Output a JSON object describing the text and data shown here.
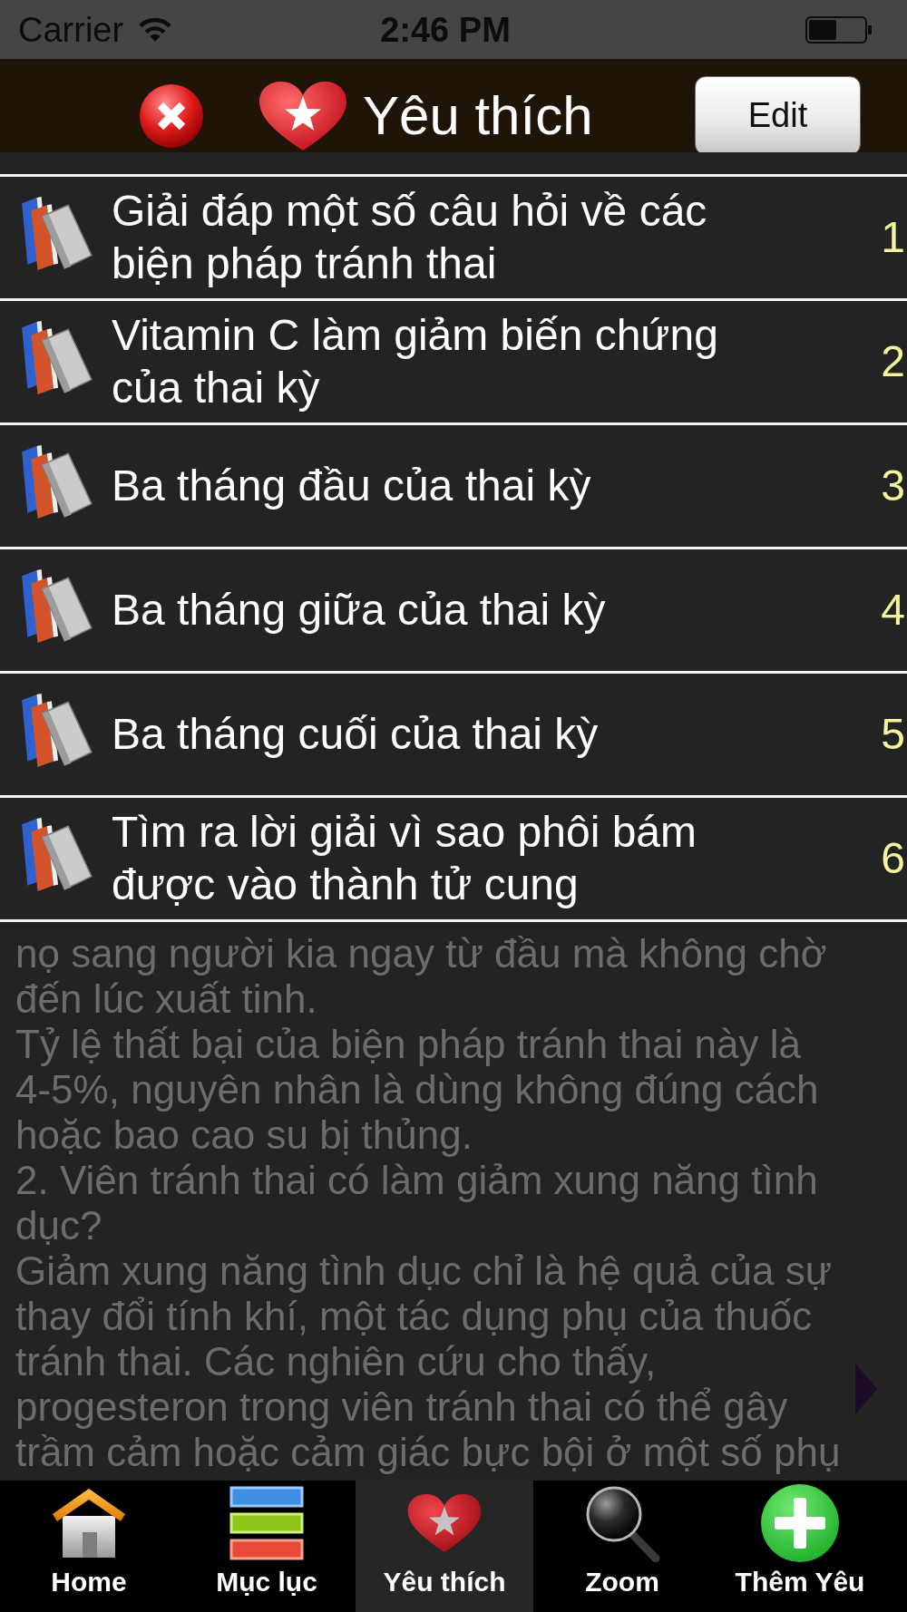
{
  "status_bar": {
    "carrier": "Carrier",
    "time": "2:46 PM"
  },
  "header": {
    "title": "Yêu thích",
    "edit_button": "Edit"
  },
  "favorites": [
    {
      "title": "Giải đáp một số câu hỏi về các biện pháp tránh thai",
      "number": "1"
    },
    {
      "title": "Vitamin C làm giảm biến chứng của thai kỳ",
      "number": "2"
    },
    {
      "title": "Ba tháng đầu của thai kỳ",
      "number": "3"
    },
    {
      "title": "Ba tháng giữa của thai kỳ",
      "number": "4"
    },
    {
      "title": "Ba tháng cuối của thai kỳ",
      "number": "5"
    },
    {
      "title": "Tìm ra lời giải vì sao phôi bám được vào thành tử cung",
      "number": "6"
    }
  ],
  "article": {
    "paragraphs": [
      {
        "lines": [
          "nọ sang người kia ngay từ đầu mà không chờ",
          "đến lúc xuất tinh."
        ]
      },
      {
        "lines": [
          "Tỷ lệ thất bại của biện pháp tránh thai này là",
          "4-5%, nguyên nhân là dùng không đúng cách",
          "hoặc bao cao su bị thủng."
        ]
      },
      {
        "lines": [
          "2. Viên tránh thai có làm giảm xung năng tình",
          "dục?"
        ]
      },
      {
        "lines": [
          "Giảm xung năng tình dục chỉ là hệ quả của sự",
          "thay đổi tính khí, một tác dụng phụ của thuốc",
          "tránh thai. Các nghiên cứu cho thấy,",
          "progesteron trong viên tránh thai có thể gây",
          "trầm cảm hoặc cảm giác bực bội ở một số phụ"
        ]
      }
    ]
  },
  "tab_bar": {
    "tabs": [
      {
        "label": "Home",
        "selected": false
      },
      {
        "label": "Mục lục",
        "selected": false
      },
      {
        "label": "Yêu thích",
        "selected": true
      },
      {
        "label": "Zoom",
        "selected": false
      },
      {
        "label": "Thêm Yêu",
        "selected": false
      }
    ]
  }
}
